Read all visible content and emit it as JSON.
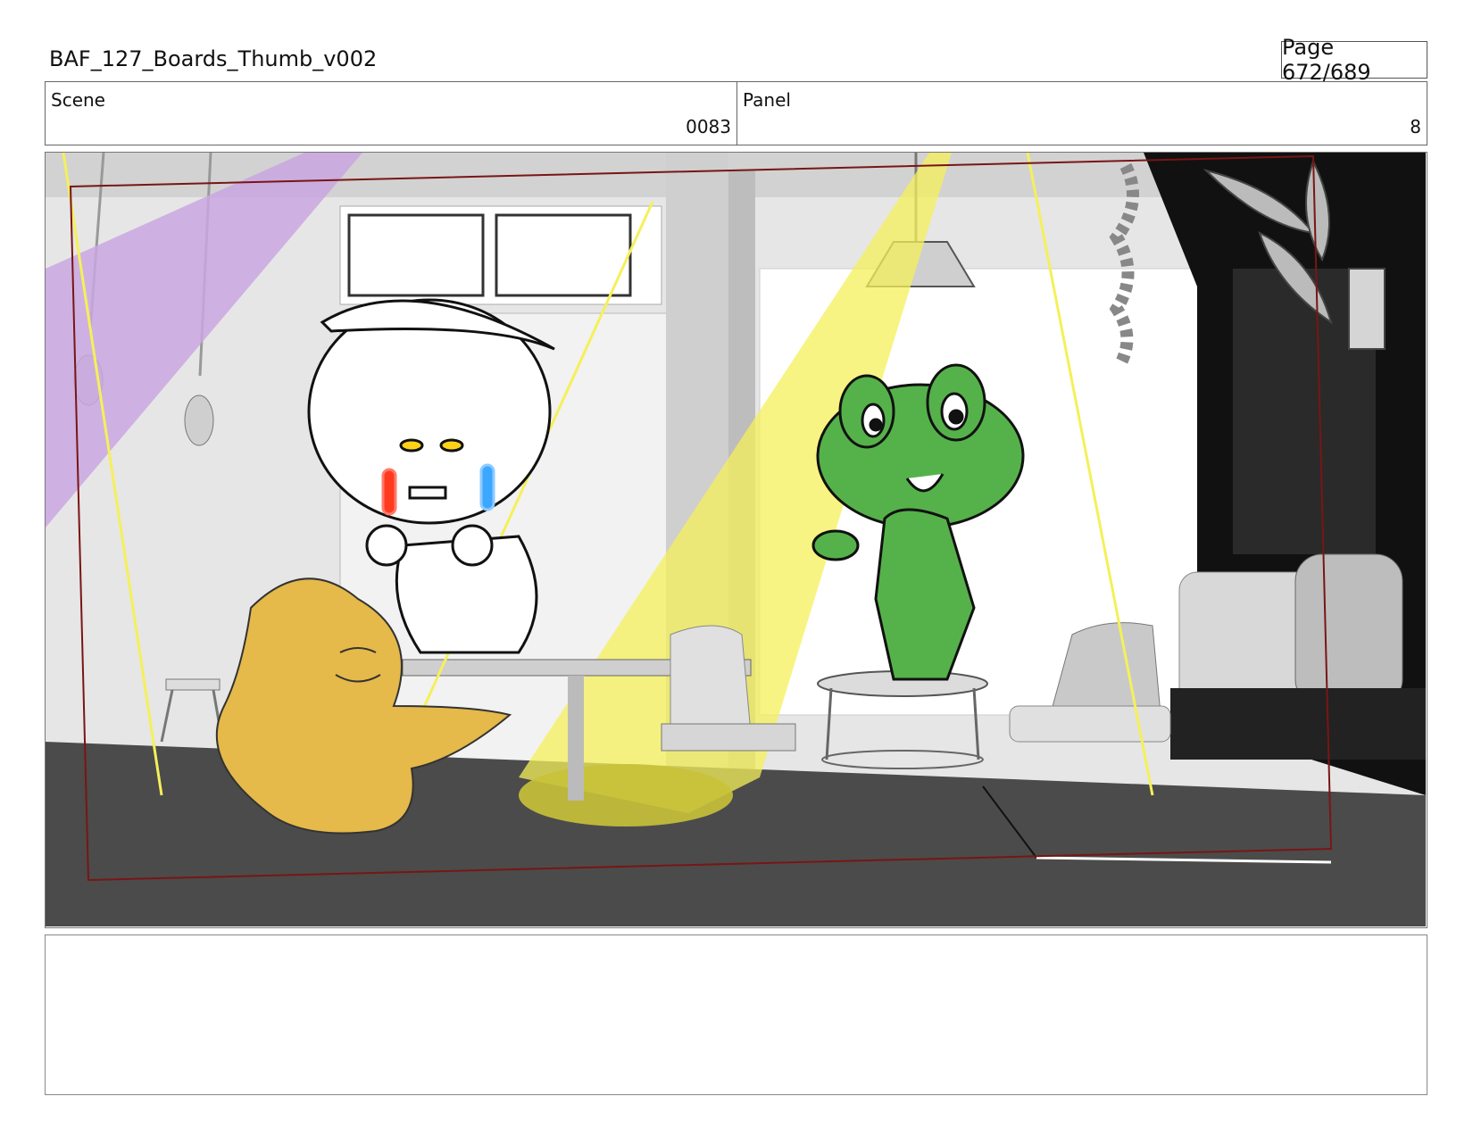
{
  "header": {
    "title": "BAF_127_Boards_Thumb_v002",
    "page": "Page 672/689"
  },
  "info": {
    "scene_label": "Scene",
    "scene_value": "0083",
    "panel_label": "Panel",
    "panel_value": "8"
  },
  "notes": {
    "text": ""
  },
  "colors": {
    "purple_light": "#c9a7e0",
    "yellow_light": "#f5f05a",
    "frog_green": "#55b24a",
    "blob_orange": "#e5b94a",
    "floor": "#4b4b4b",
    "frame_guide": "#7a1515"
  }
}
